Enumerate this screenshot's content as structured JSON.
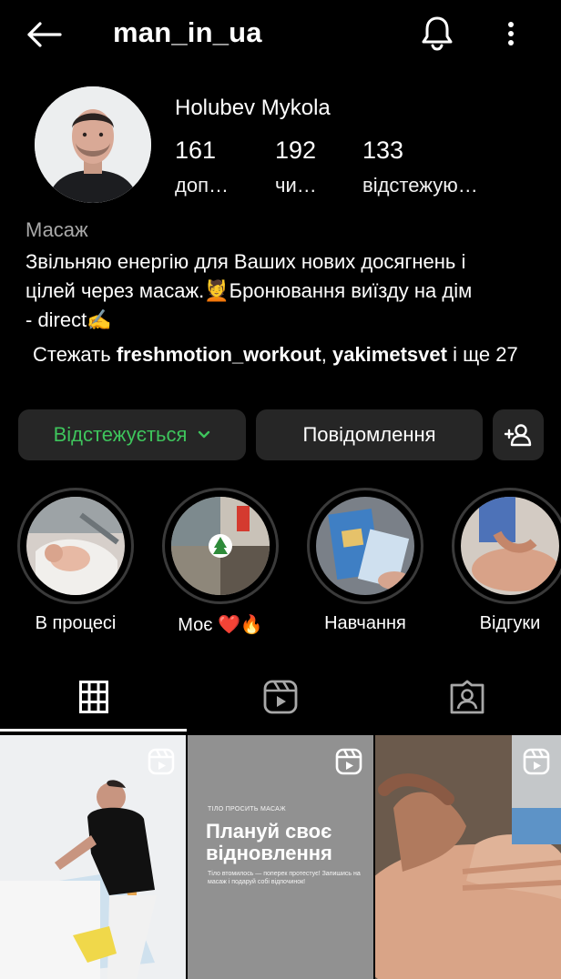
{
  "header": {
    "username": "man_in_ua"
  },
  "profile": {
    "full_name": "Holubev Mykola",
    "stats": [
      {
        "value": "161",
        "label": "доп…"
      },
      {
        "value": "192",
        "label": "чи…"
      },
      {
        "value": "133",
        "label": "відстежую…"
      }
    ],
    "category": "Масаж",
    "bio_line1": "Звільняю енергію для Ваших нових досягнень і",
    "bio_line2": "цілей через масаж.💆Бронювання виїзду на дім",
    "bio_line3": "- direct✍️",
    "followed_by": {
      "prefix": "Стежать ",
      "user1": "freshmotion_workout",
      "separator": ", ",
      "user2": "yakimetsvet",
      "suffix": " і ще 27"
    }
  },
  "actions": {
    "following_label": "Відстежується",
    "message_label": "Повідомлення"
  },
  "highlights": [
    {
      "label": "В процесі"
    },
    {
      "label": "Моє ❤️🔥"
    },
    {
      "label": "Навчання"
    },
    {
      "label": "Відгуки"
    }
  ],
  "tabs": [
    "grid",
    "reels",
    "tagged"
  ],
  "posts": [
    {
      "type": "reel"
    },
    {
      "type": "reel",
      "small_heading": "ТІЛО ПРОСИТЬ МАСАЖ",
      "title_line1": "Плануй своє",
      "title_line2": "відновлення",
      "subtitle": "Тіло втомилось — поперек протестує! Запишись на масаж і подаруй собі відпочинок!"
    },
    {
      "type": "reel"
    }
  ],
  "colors": {
    "background": "#000000",
    "button_bg": "#262626",
    "following_green": "#3ec45c",
    "secondary_text": "#a8a8a8"
  }
}
